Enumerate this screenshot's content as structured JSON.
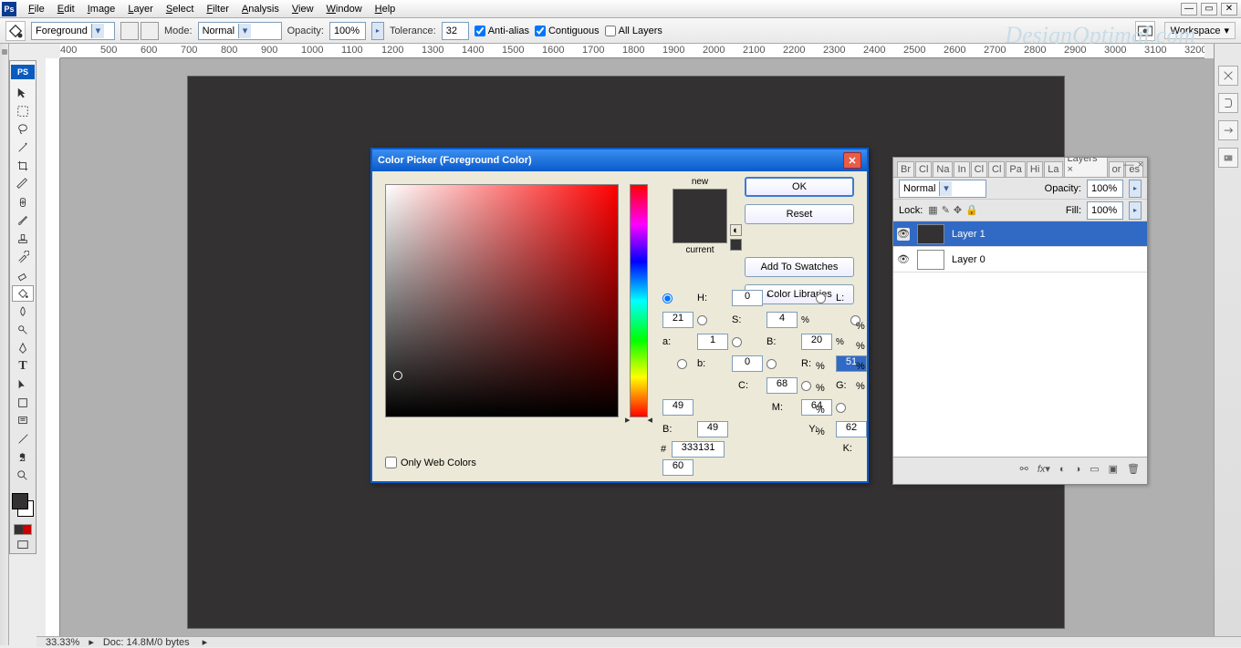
{
  "menu": [
    "File",
    "Edit",
    "Image",
    "Layer",
    "Select",
    "Filter",
    "Analysis",
    "View",
    "Window",
    "Help"
  ],
  "options": {
    "fill_label": "Foreground",
    "mode_label": "Mode:",
    "mode_value": "Normal",
    "opacity_label": "Opacity:",
    "opacity_value": "100%",
    "tolerance_label": "Tolerance:",
    "tolerance_value": "32",
    "antialias": "Anti-alias",
    "contiguous": "Contiguous",
    "alllayers": "All Layers",
    "workspace": "Workspace"
  },
  "watermark": "DesignOptimal.com",
  "ruler_marks": [
    "400",
    "500",
    "600",
    "700",
    "800",
    "900",
    "1000",
    "1100",
    "1200",
    "1300",
    "1400",
    "1500",
    "1600",
    "1700",
    "1800",
    "1900",
    "2000",
    "2100",
    "2200",
    "2300",
    "2400",
    "2500",
    "2600",
    "2700",
    "2800",
    "2900",
    "3000",
    "3100",
    "3200"
  ],
  "dialog": {
    "title": "Color Picker (Foreground Color)",
    "new": "new",
    "current": "current",
    "ok": "OK",
    "reset": "Reset",
    "add": "Add To Swatches",
    "lib": "Color Libraries",
    "H": "0",
    "S": "4",
    "B": "20",
    "L": "21",
    "a": "1",
    "b2": "0",
    "R": "51",
    "G": "49",
    "Bb": "49",
    "C": "68",
    "M": "64",
    "Y": "62",
    "K": "60",
    "hex": "333131",
    "web": "Only Web Colors",
    "new_color": "#333131",
    "cur_color": "#333131"
  },
  "layers_panel": {
    "tabs": [
      "Br",
      "Cl",
      "Na",
      "In",
      "Cl",
      "Cl",
      "Pa",
      "Hi",
      "La",
      "Layers ×",
      "or",
      "es"
    ],
    "blend": "Normal",
    "opacity_lbl": "Opacity:",
    "opacity": "100%",
    "lock_lbl": "Lock:",
    "fill_lbl": "Fill:",
    "fill": "100%",
    "rows": [
      {
        "name": "Layer 1",
        "color": "#333131",
        "selected": true
      },
      {
        "name": "Layer 0",
        "color": "#ffffff",
        "selected": false
      }
    ]
  },
  "status": {
    "zoom": "33.33%",
    "doc": "Doc: 14.8M/0 bytes"
  }
}
